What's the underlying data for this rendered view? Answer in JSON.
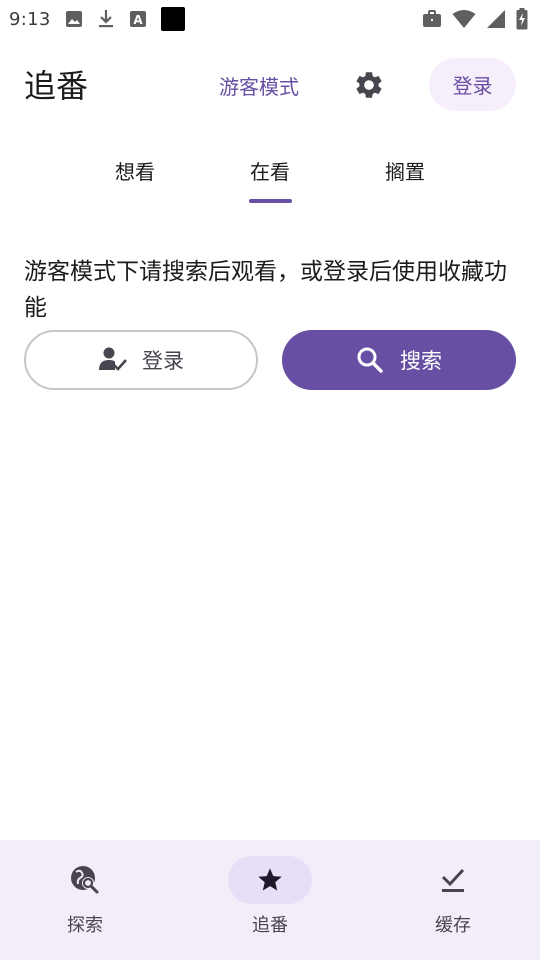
{
  "status_bar": {
    "time": "9:13",
    "left_icons": [
      "image-icon",
      "download-icon",
      "font-icon",
      "black-square-icon"
    ],
    "right_icons": [
      "briefcase-icon",
      "wifi-icon",
      "signal-icon",
      "battery-charging-icon"
    ]
  },
  "header": {
    "title": "追番",
    "guest_mode_label": "游客模式",
    "settings_icon": "gear-icon",
    "login_label": "登录"
  },
  "tabs": [
    {
      "label": "想看",
      "active": false
    },
    {
      "label": "在看",
      "active": true
    },
    {
      "label": "搁置",
      "active": false
    }
  ],
  "main": {
    "message": "游客模式下请搜索后观看，或登录后使用收藏功能",
    "login_button_label": "登录",
    "login_button_icon": "person-check-icon",
    "search_button_label": "搜索",
    "search_button_icon": "search-icon"
  },
  "bottom_nav": [
    {
      "label": "探索",
      "icon": "explore-search-icon",
      "active": false
    },
    {
      "label": "追番",
      "icon": "star-icon",
      "active": true
    },
    {
      "label": "缓存",
      "icon": "download-done-icon",
      "active": false
    }
  ],
  "colors": {
    "accent": "#6750a4",
    "accent_container": "#e8def8",
    "nav_background": "#f3edf7",
    "login_chip_background": "#f6eefa"
  }
}
